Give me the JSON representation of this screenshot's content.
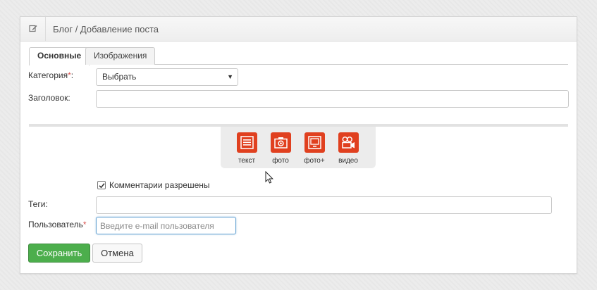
{
  "header": {
    "title": "Блог / Добавление поста",
    "icon": "edit-icon"
  },
  "tabs": [
    {
      "label": "Основные",
      "active": true
    },
    {
      "label": "Изображения",
      "active": false
    }
  ],
  "form": {
    "category": {
      "label": "Категория",
      "required_mark": "*",
      "suffix": ":",
      "value": "Выбрать"
    },
    "title": {
      "label": "Заголовок:",
      "value": ""
    },
    "media_buttons": [
      {
        "label": "текст",
        "icon": "text-icon"
      },
      {
        "label": "фото",
        "icon": "camera-icon"
      },
      {
        "label": "фото+",
        "icon": "gallery-icon"
      },
      {
        "label": "видео",
        "icon": "video-camera-icon"
      }
    ],
    "comments": {
      "label": "Комментарии разрешены",
      "checked": true
    },
    "tags": {
      "label": "Теги:",
      "value": ""
    },
    "user": {
      "label": "Пользователь",
      "required_mark": "*",
      "placeholder": "Введите e-mail пользователя",
      "value": ""
    }
  },
  "buttons": {
    "save": "Сохранить",
    "cancel": "Отмена"
  },
  "colors": {
    "accent_orange": "#e0401f",
    "save_green": "#4cae4c",
    "required_red": "#d9534f",
    "focus_blue": "#66a3d2"
  }
}
